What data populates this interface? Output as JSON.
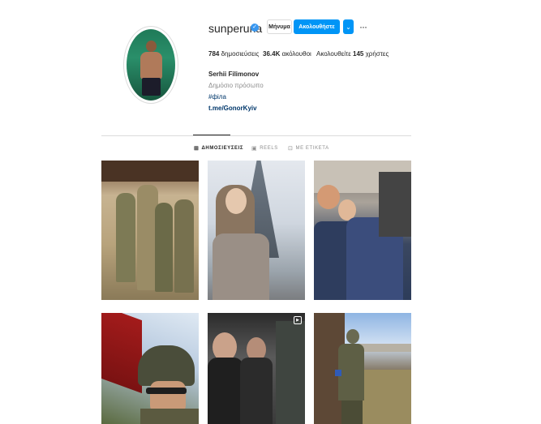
{
  "profile": {
    "username": "sunperuna",
    "verified_icon": "verified-badge-icon",
    "buttons": {
      "message": "Μήνυμα",
      "follow": "Ακολουθήστε",
      "more": "⌄",
      "options": "···"
    },
    "stats": {
      "posts_count": "784",
      "posts_label": "δημοσιεύσεις",
      "followers_count": "36.4K",
      "followers_label": "ακόλουθοι",
      "following_prefix": "Ακολουθείτε",
      "following_count": "145",
      "following_suffix": "χρήστες"
    },
    "full_name": "Serhii Filimonov",
    "category": "Δημόσιο πρόσωπο",
    "bio_hashtag": "#фiла",
    "bio_link": "t.me/GonorKyiv"
  },
  "tabs": [
    {
      "label": "ΔΗΜΟΣΙΕΥΣΕΙΣ",
      "icon": "grid-icon"
    },
    {
      "label": "REELS",
      "icon": "reels-icon"
    },
    {
      "label": "ΜΕ ΕΤΙΚΕΤΑ",
      "icon": "tagged-icon"
    }
  ],
  "colors": {
    "accent": "#0095f6",
    "link": "#00376b",
    "muted": "#8e8e8e",
    "divider": "#dbdbdb"
  }
}
